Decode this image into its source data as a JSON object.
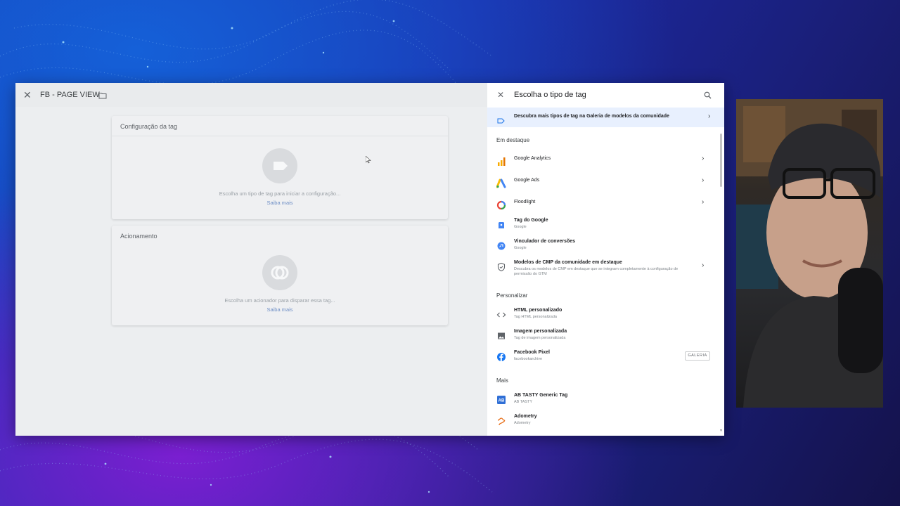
{
  "left": {
    "header": {
      "close_icon": "close-icon",
      "title": "FB - PAGE VIEW",
      "folder_icon": "folder-icon"
    },
    "tag_card": {
      "title": "Configuração da tag",
      "description": "Escolha um tipo de tag para iniciar a configuração...",
      "link": "Saiba mais"
    },
    "trigger_card": {
      "title": "Acionamento",
      "description": "Escolha um acionador para disparar essa tag...",
      "link": "Saiba mais"
    }
  },
  "panel": {
    "title": "Escolha o tipo de tag",
    "banner": "Descubra mais tipos de tag na Galeria de modelos da comunidade",
    "sections": {
      "featured": "Em destaque",
      "custom": "Personalizar",
      "more": "Mais"
    },
    "featured": [
      {
        "name": "Google Analytics",
        "sub": "",
        "icon": "analytics-icon",
        "chevron": true
      },
      {
        "name": "Google Ads",
        "sub": "",
        "icon": "google-ads-icon",
        "chevron": true
      },
      {
        "name": "Floodlight",
        "sub": "",
        "icon": "floodlight-icon",
        "chevron": true
      },
      {
        "name": "Tag do Google",
        "sub": "Google",
        "icon": "google-tag-icon",
        "chevron": false
      },
      {
        "name": "Vinculador de conversões",
        "sub": "Google",
        "icon": "conversion-linker-icon",
        "chevron": false
      },
      {
        "name": "Modelos de CMP da comunidade em destaque",
        "sub": "Descubra os modelos de CMP em destaque que se integram completamente à configuração de permissão do GTM",
        "icon": "shield-icon",
        "chevron": true
      }
    ],
    "custom": [
      {
        "name": "HTML personalizado",
        "sub": "Tag HTML personalizada",
        "icon": "code-icon"
      },
      {
        "name": "Imagem personalizada",
        "sub": "Tag de imagem personalizada",
        "icon": "image-icon"
      },
      {
        "name": "Facebook Pixel",
        "sub": "facebookarchive",
        "icon": "facebook-icon",
        "badge": "GALERIA"
      }
    ],
    "more": [
      {
        "name": "AB TASTY Generic Tag",
        "sub": "AB TASTY",
        "icon": "abtasty-icon"
      },
      {
        "name": "Adometry",
        "sub": "Adometry",
        "icon": "adometry-icon"
      }
    ]
  }
}
